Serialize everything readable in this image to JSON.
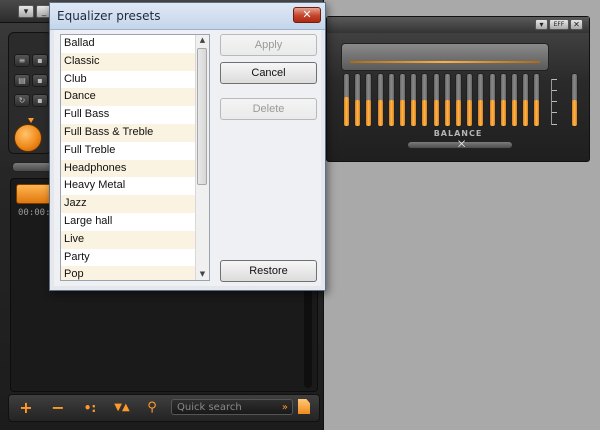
{
  "player": {
    "timecode": "00:00:0",
    "quick_search_placeholder": "Quick search",
    "quick_search_go": "»",
    "add_label": "+",
    "remove_label": "−",
    "shuffle_label": "•:",
    "sort_label": "▼▲",
    "search_label": "⚲"
  },
  "equalizer": {
    "title_buttons": [
      "▾",
      "EFF",
      "✕"
    ],
    "band_levels": [
      0.55,
      0.5,
      0.5,
      0.5,
      0.5,
      0.5,
      0.5,
      0.5,
      0.5,
      0.5,
      0.5,
      0.5,
      0.5,
      0.5,
      0.5,
      0.5,
      0.5,
      0.5
    ],
    "preamp_level": 0.5,
    "balance_label": "BALANCE",
    "balance_value": 0.5,
    "balance_knob": "⨉"
  },
  "dialog": {
    "title": "Equalizer presets",
    "close_label": "✕",
    "presets": [
      "Ballad",
      "Classic",
      "Club",
      "Dance",
      "Full Bass",
      "Full Bass & Treble",
      "Full Treble",
      "Headphones",
      "Heavy Metal",
      "Jazz",
      "Large hall",
      "Live",
      "Party",
      "Pop"
    ],
    "scroll_up": "▲",
    "scroll_down": "▼",
    "buttons": {
      "apply": "Apply",
      "cancel": "Cancel",
      "delete": "Delete",
      "restore": "Restore"
    }
  },
  "colors": {
    "accent": "#ff9a2a",
    "dialog_bg": "#eef0f3",
    "list_alt_row": "#fbf3e1",
    "close_button": "#c4432a"
  }
}
